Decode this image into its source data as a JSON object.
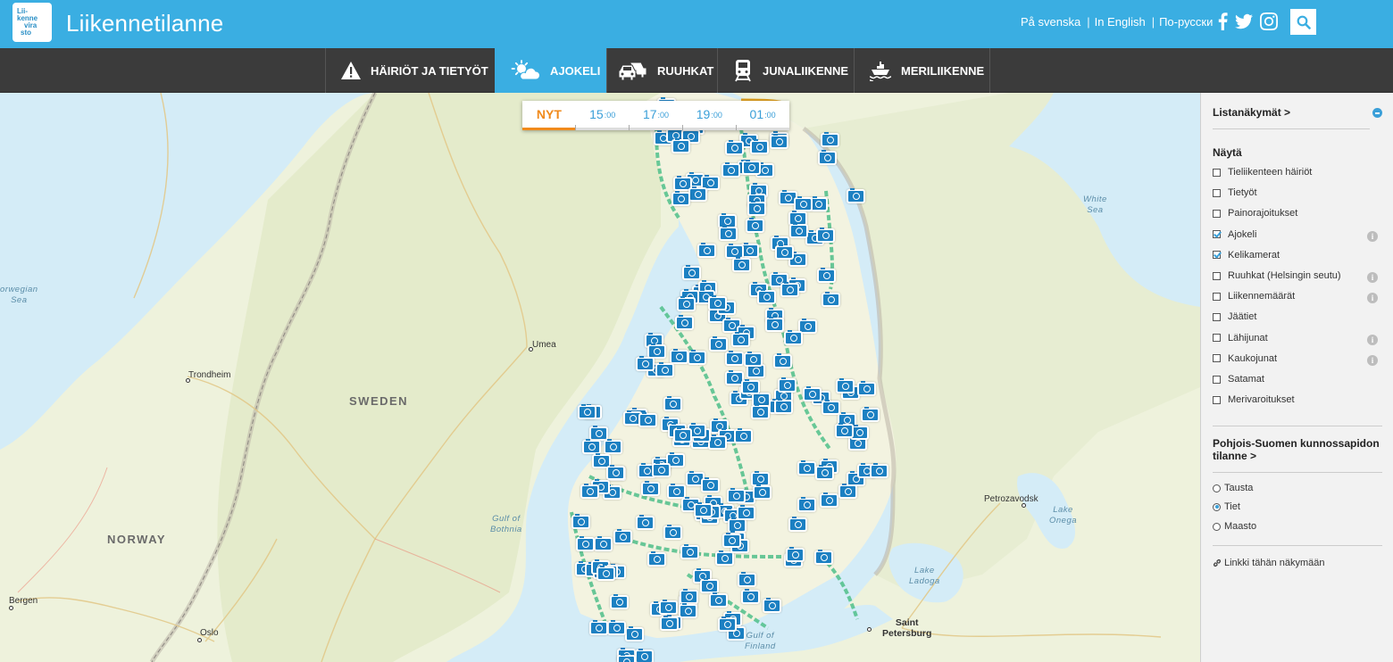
{
  "header": {
    "logo_lines": [
      "Lii-",
      "kenne",
      "vira",
      "sto"
    ],
    "title": "Liikennetilanne",
    "languages": [
      "På svenska",
      "In English",
      "По-русски"
    ],
    "social_icons": [
      "facebook-icon",
      "twitter-icon",
      "instagram-icon"
    ],
    "search_icon": "search-icon"
  },
  "nav": {
    "items": [
      {
        "label": "HÄIRIÖT JA TIETYÖT",
        "icon": "warning-icon",
        "active": false
      },
      {
        "label": "AJOKELI",
        "icon": "weather-icon",
        "active": true
      },
      {
        "label": "RUUHKAT",
        "icon": "cars-icon",
        "active": false
      },
      {
        "label": "JUNALIIKENNE",
        "icon": "train-icon",
        "active": false
      },
      {
        "label": "MERILIIKENNE",
        "icon": "ship-icon",
        "active": false
      }
    ]
  },
  "timebar": {
    "tabs": [
      {
        "hour": "NYT",
        "min": ""
      },
      {
        "hour": "15",
        "min": ":00"
      },
      {
        "hour": "17",
        "min": ":00"
      },
      {
        "hour": "19",
        "min": ":00"
      },
      {
        "hour": "01",
        "min": ":00"
      }
    ]
  },
  "map": {
    "labels": {
      "norwegian_sea_1": "orwegian",
      "norwegian_sea_2": "Sea",
      "white_sea_1": "White",
      "white_sea_2": "Sea",
      "trondheim": "Trondheim",
      "umea": "Umea",
      "sweden": "SWEDEN",
      "norway": "NORWAY",
      "bergen": "Bergen",
      "oslo": "Oslo",
      "gulf_bothnia_1": "Gulf of",
      "gulf_bothnia_2": "Bothnia",
      "gulf_finland_1": "Gulf of",
      "gulf_finland_2": "Finland",
      "petrozavodsk": "Petrozavodsk",
      "lake_onega_1": "Lake",
      "lake_onega_2": "Onega",
      "lake_ladoga_1": "Lake",
      "lake_ladoga_2": "Ladoga",
      "saint_1": "Saint",
      "saint_2": "Petersburg"
    },
    "camera_icon": "camera-icon"
  },
  "panel": {
    "list_views": "Listanäkymät >",
    "show_heading": "Näytä",
    "layers": [
      {
        "label": "Tieliikenteen häiriöt",
        "checked": false,
        "info": false
      },
      {
        "label": "Tietyöt",
        "checked": false,
        "info": false
      },
      {
        "label": "Painorajoitukset",
        "checked": false,
        "info": false
      },
      {
        "label": "Ajokeli",
        "checked": true,
        "info": true
      },
      {
        "label": "Kelikamerat",
        "checked": true,
        "info": false
      },
      {
        "label": "Ruuhkat (Helsingin seutu)",
        "checked": false,
        "info": true
      },
      {
        "label": "Liikennemäärät",
        "checked": false,
        "info": true
      },
      {
        "label": "Jäätiet",
        "checked": false,
        "info": false
      },
      {
        "label": "Lähijunat",
        "checked": false,
        "info": true
      },
      {
        "label": "Kaukojunat",
        "checked": false,
        "info": true
      },
      {
        "label": "Satamat",
        "checked": false,
        "info": false
      },
      {
        "label": "Merivaroitukset",
        "checked": false,
        "info": false
      }
    ],
    "info_glyph": "i",
    "maintenance_link_1": "Pohjois-Suomen kunnossapidon",
    "maintenance_link_2": "tilanne >",
    "basemaps": [
      {
        "label": "Tausta",
        "selected": false
      },
      {
        "label": "Tiet",
        "selected": true
      },
      {
        "label": "Maasto",
        "selected": false
      }
    ],
    "link_here": "Linkki tähän näkymään",
    "colors": {
      "accent": "#3aaee2",
      "nav_bg": "#3b3b3b",
      "camera": "#1c80c2",
      "timebar_active": "#f08a1c"
    }
  }
}
